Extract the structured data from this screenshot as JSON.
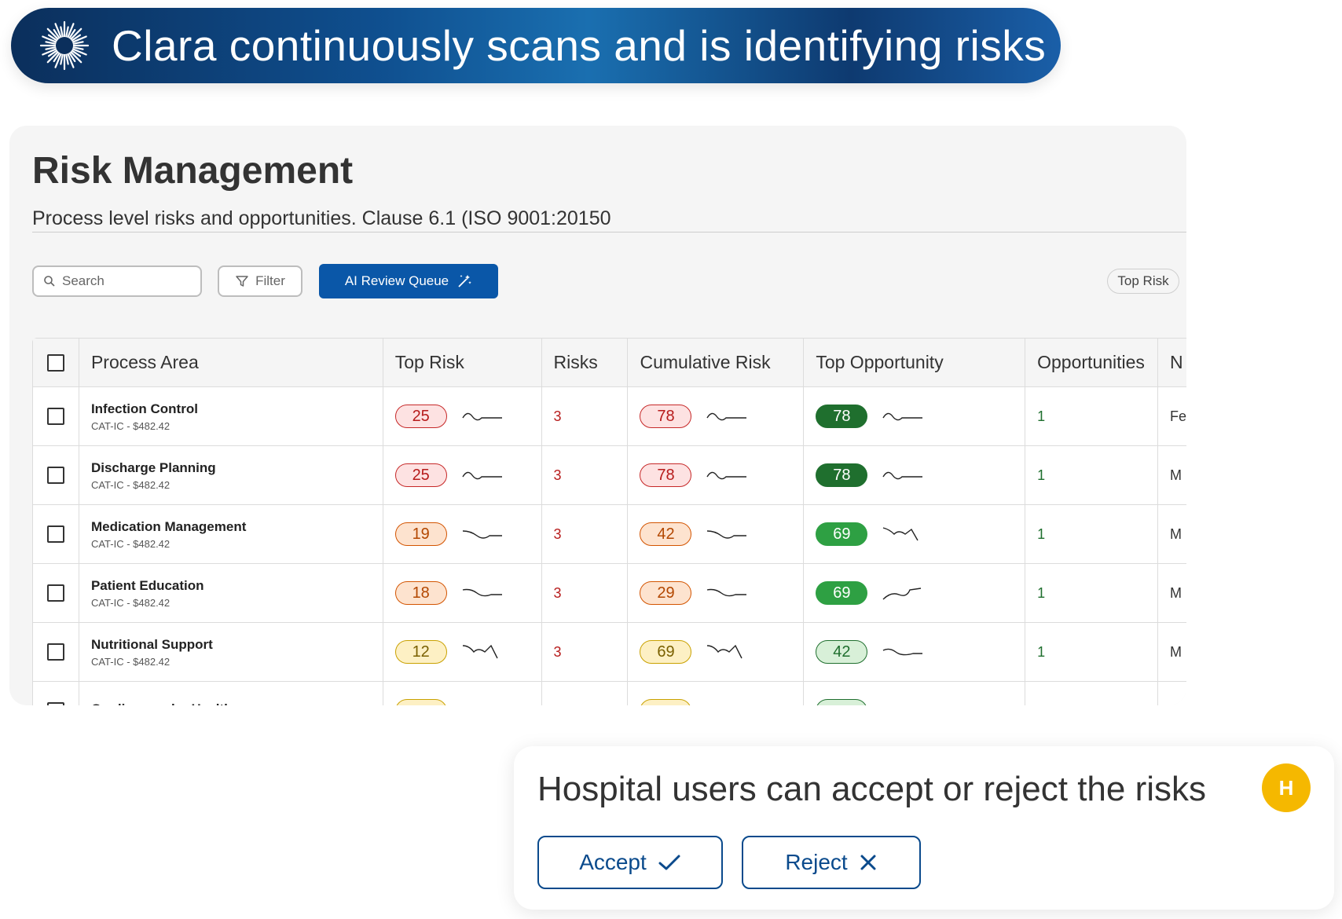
{
  "banner": {
    "title": "Clara continuously scans and is identifying risks",
    "icon": "starburst-icon"
  },
  "page": {
    "title": "Risk Management",
    "subtitle": "Process level risks and opportunities. Clause 6.1 (ISO 9001:20150"
  },
  "toolbar": {
    "search_placeholder": "Search",
    "filter_label": "Filter",
    "ai_review_label": "AI Review Queue",
    "top_risk_chip": "Top Risk"
  },
  "table": {
    "headers": [
      "Process Area",
      "Top Risk",
      "Risks",
      "Cumulative Risk",
      "Top Opportunity",
      "Opportunities",
      "N"
    ],
    "rows": [
      {
        "name": "Infection Control",
        "sub": "CAT-IC - $482.42",
        "top_risk": "25",
        "risks": "3",
        "cum_risk": "78",
        "top_opp": "78",
        "opps": "1",
        "next": "Fe"
      },
      {
        "name": "Discharge Planning",
        "sub": "CAT-IC - $482.42",
        "top_risk": "25",
        "risks": "3",
        "cum_risk": "78",
        "top_opp": "78",
        "opps": "1",
        "next": "M"
      },
      {
        "name": "Medication Management",
        "sub": "CAT-IC - $482.42",
        "top_risk": "19",
        "risks": "3",
        "cum_risk": "42",
        "top_opp": "69",
        "opps": "1",
        "next": "M"
      },
      {
        "name": "Patient Education",
        "sub": "CAT-IC - $482.42",
        "top_risk": "18",
        "risks": "3",
        "cum_risk": "29",
        "top_opp": "69",
        "opps": "1",
        "next": "M"
      },
      {
        "name": "Nutritional Support",
        "sub": "CAT-IC - $482.42",
        "top_risk": "12",
        "risks": "3",
        "cum_risk": "69",
        "top_opp": "42",
        "opps": "1",
        "next": "M"
      },
      {
        "name": "Cardiovascular Health",
        "sub": "",
        "top_risk": "",
        "risks": "",
        "cum_risk": "",
        "top_opp": "",
        "opps": "",
        "next": ""
      }
    ]
  },
  "colors": {
    "risk_high_bg": "#fde2e2",
    "risk_high_border": "#c62828",
    "risk_high_text": "#b71c1c",
    "risk_med_bg": "#fde3cf",
    "risk_med_border": "#d35400",
    "risk_med_text": "#b34700",
    "risk_low_bg": "#fdf0c4",
    "risk_low_border": "#c9a100",
    "risk_low_text": "#7a6000",
    "opp_dark": "#1f6f2e",
    "opp_mid": "#2ea043",
    "opp_light_bg": "#d8f0d8"
  },
  "panel": {
    "message": "Hospital users can accept or reject the risks",
    "avatar_initial": "H",
    "accept_label": "Accept",
    "reject_label": "Reject"
  }
}
